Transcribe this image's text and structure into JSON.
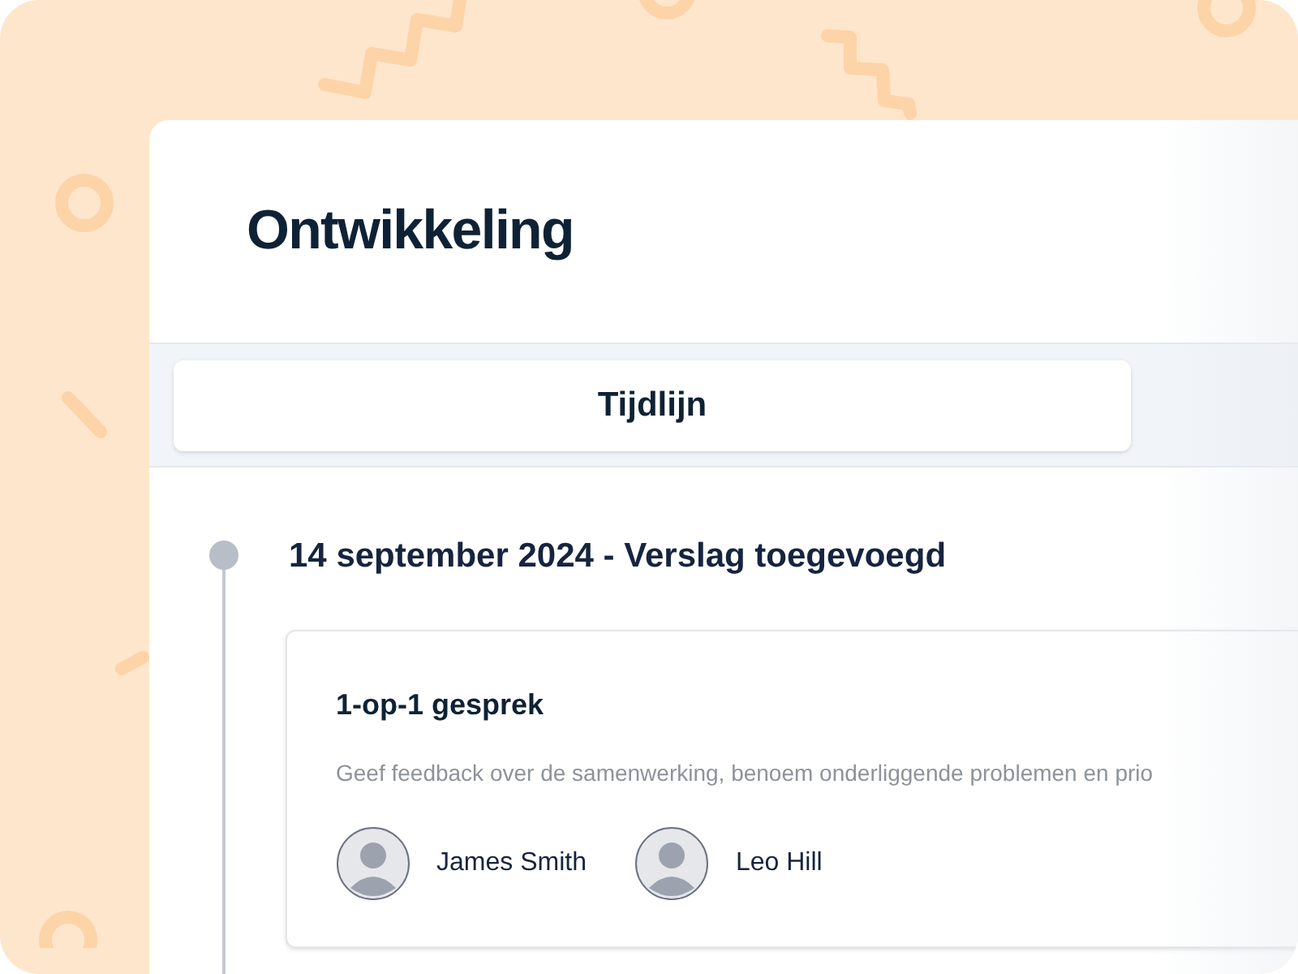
{
  "page": {
    "title": "Ontwikkeling"
  },
  "tabs": [
    {
      "label": "Tijdlijn",
      "selected": true
    }
  ],
  "timeline": [
    {
      "heading": "14 september 2024 - Verslag toegevoegd",
      "card": {
        "title": "1-op-1 gesprek",
        "description": "Geef feedback over de samenwerking, benoem onderliggende problemen en prio",
        "people": [
          {
            "name": "James Smith"
          },
          {
            "name": "Leo Hill"
          }
        ]
      }
    }
  ]
}
